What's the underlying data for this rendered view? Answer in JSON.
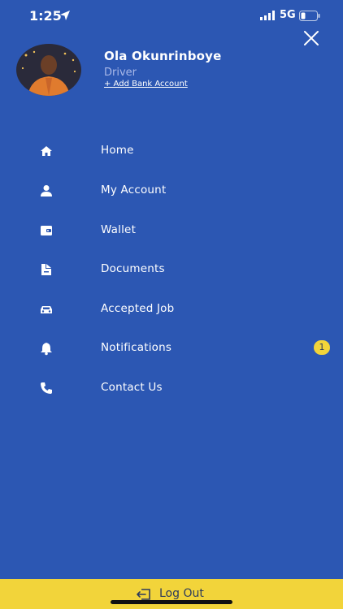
{
  "status_bar": {
    "time": "1:25",
    "network": "5G"
  },
  "profile": {
    "name": "Ola Okunrinboye",
    "role": "Driver",
    "add_bank": "+ Add Bank Account"
  },
  "menu": {
    "items": [
      {
        "label": "Home",
        "icon": "home-icon"
      },
      {
        "label": "My Account",
        "icon": "user-icon"
      },
      {
        "label": "Wallet",
        "icon": "wallet-icon"
      },
      {
        "label": "Documents",
        "icon": "documents-icon"
      },
      {
        "label": "Accepted Job",
        "icon": "car-icon"
      },
      {
        "label": "Notifications",
        "icon": "bell-icon",
        "badge": "1"
      },
      {
        "label": "Contact Us",
        "icon": "phone-icon"
      }
    ]
  },
  "logout": {
    "label": "Log Out"
  },
  "colors": {
    "background": "#2c57b3",
    "accent": "#f2d43a",
    "muted_text": "#a9b8e8"
  }
}
